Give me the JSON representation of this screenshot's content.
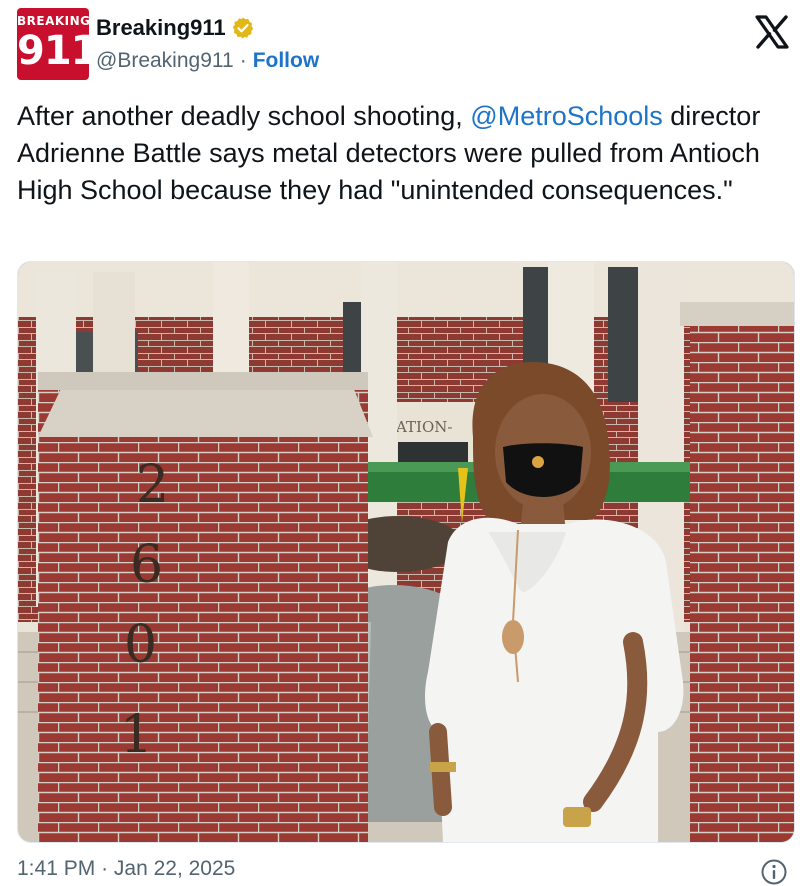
{
  "account": {
    "avatar_top_text": "BREAKING",
    "avatar_number": "911",
    "display_name": "Breaking911",
    "handle": "@Breaking911",
    "separator": "·",
    "follow_label": "Follow",
    "verified_icon": "gold-verified-badge-icon"
  },
  "tweet": {
    "text_before": "After another deadly school shooting, ",
    "mention": "@MetroSchools",
    "text_after": " director Adrienne Battle says metal detectors were pulled from Antioch High School because they had \"unintended consequences.\""
  },
  "photo": {
    "address_digits": [
      "2",
      "6",
      "0",
      "1"
    ],
    "building_sign": "ATION-"
  },
  "meta": {
    "time": "1:41 PM",
    "separator": "·",
    "date": "Jan 22, 2025"
  },
  "colors": {
    "link": "#1d74c9",
    "secondary_text": "#536471",
    "brand_red": "#c8102e",
    "verified_gold": "#e2b719"
  }
}
